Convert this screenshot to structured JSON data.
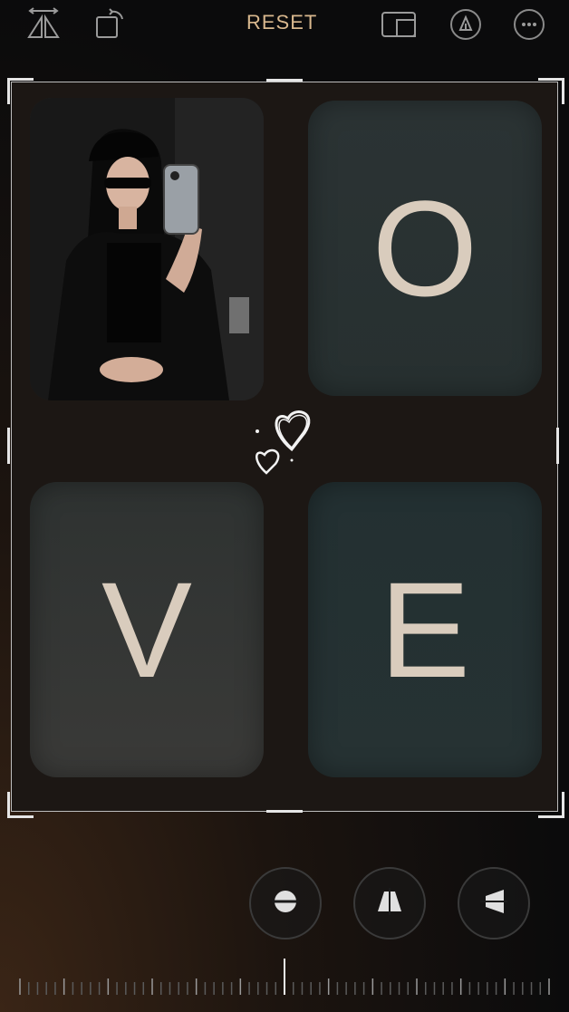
{
  "toolbar": {
    "flip_icon": "flip-horizontal-icon",
    "rotate_icon": "rotate-icon",
    "reset_label": "RESET",
    "aspect_icon": "aspect-ratio-icon",
    "markup_icon": "markup-pen-icon",
    "more_icon": "more-options-icon"
  },
  "canvas": {
    "letters": [
      "O",
      "V",
      "E"
    ],
    "photo": "mirror-selfie-photo",
    "sticker": "hearts-doodle"
  },
  "tools": {
    "straighten_icon": "straighten-icon",
    "vertical_perspective_icon": "vertical-perspective-icon",
    "horizontal_perspective_icon": "horizontal-perspective-icon"
  },
  "colors": {
    "accent": "#d9b88e",
    "tile_text": "#d9ccbd",
    "crop_border": "#e6e6e6"
  }
}
